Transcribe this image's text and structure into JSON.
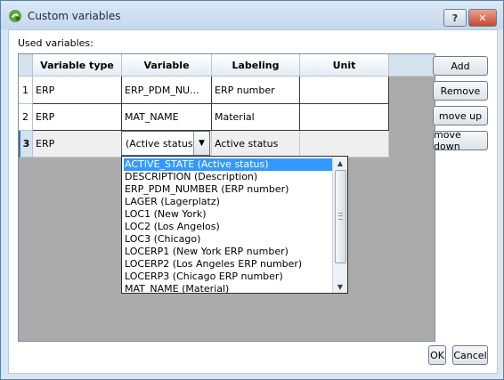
{
  "window": {
    "title": "Custom variables",
    "help_label": "?",
    "close_label": "✕"
  },
  "used_label": "Used variables:",
  "table": {
    "columns": [
      "Variable type",
      "Variable",
      "Labeling",
      "Unit"
    ],
    "rows": [
      {
        "num": "1",
        "type": "ERP",
        "variable": "ERP_PDM_NU...",
        "labeling": "ERP number",
        "unit": ""
      },
      {
        "num": "2",
        "type": "ERP",
        "variable": "MAT_NAME",
        "labeling": "Material",
        "unit": ""
      },
      {
        "num": "3",
        "type": "ERP",
        "variable": "(Active status)",
        "labeling": "Active status",
        "unit": ""
      }
    ]
  },
  "dropdown": {
    "options": [
      "ACTIVE_STATE (Active status)",
      "DESCRIPTION (Description)",
      "ERP_PDM_NUMBER (ERP number)",
      "LAGER (Lagerplatz)",
      "LOC1 (New York)",
      "LOC2 (Los Angelos)",
      "LOC3 (Chicago)",
      "LOCERP1 (New York ERP number)",
      "LOCERP2 (Los Angeles ERP number)",
      "LOCERP3 (Chicago ERP number)",
      "MAT_NAME (Material)"
    ],
    "selected": "ACTIVE_STATE (Active status)"
  },
  "buttons": {
    "add": "Add",
    "remove": "Remove",
    "move_up": "move up",
    "move_down": "move down",
    "ok": "OK",
    "cancel": "Cancel"
  },
  "colors": {
    "selection": "#3399ff",
    "close_button": "#c9462c",
    "window_frame": "#d9e6f2"
  }
}
